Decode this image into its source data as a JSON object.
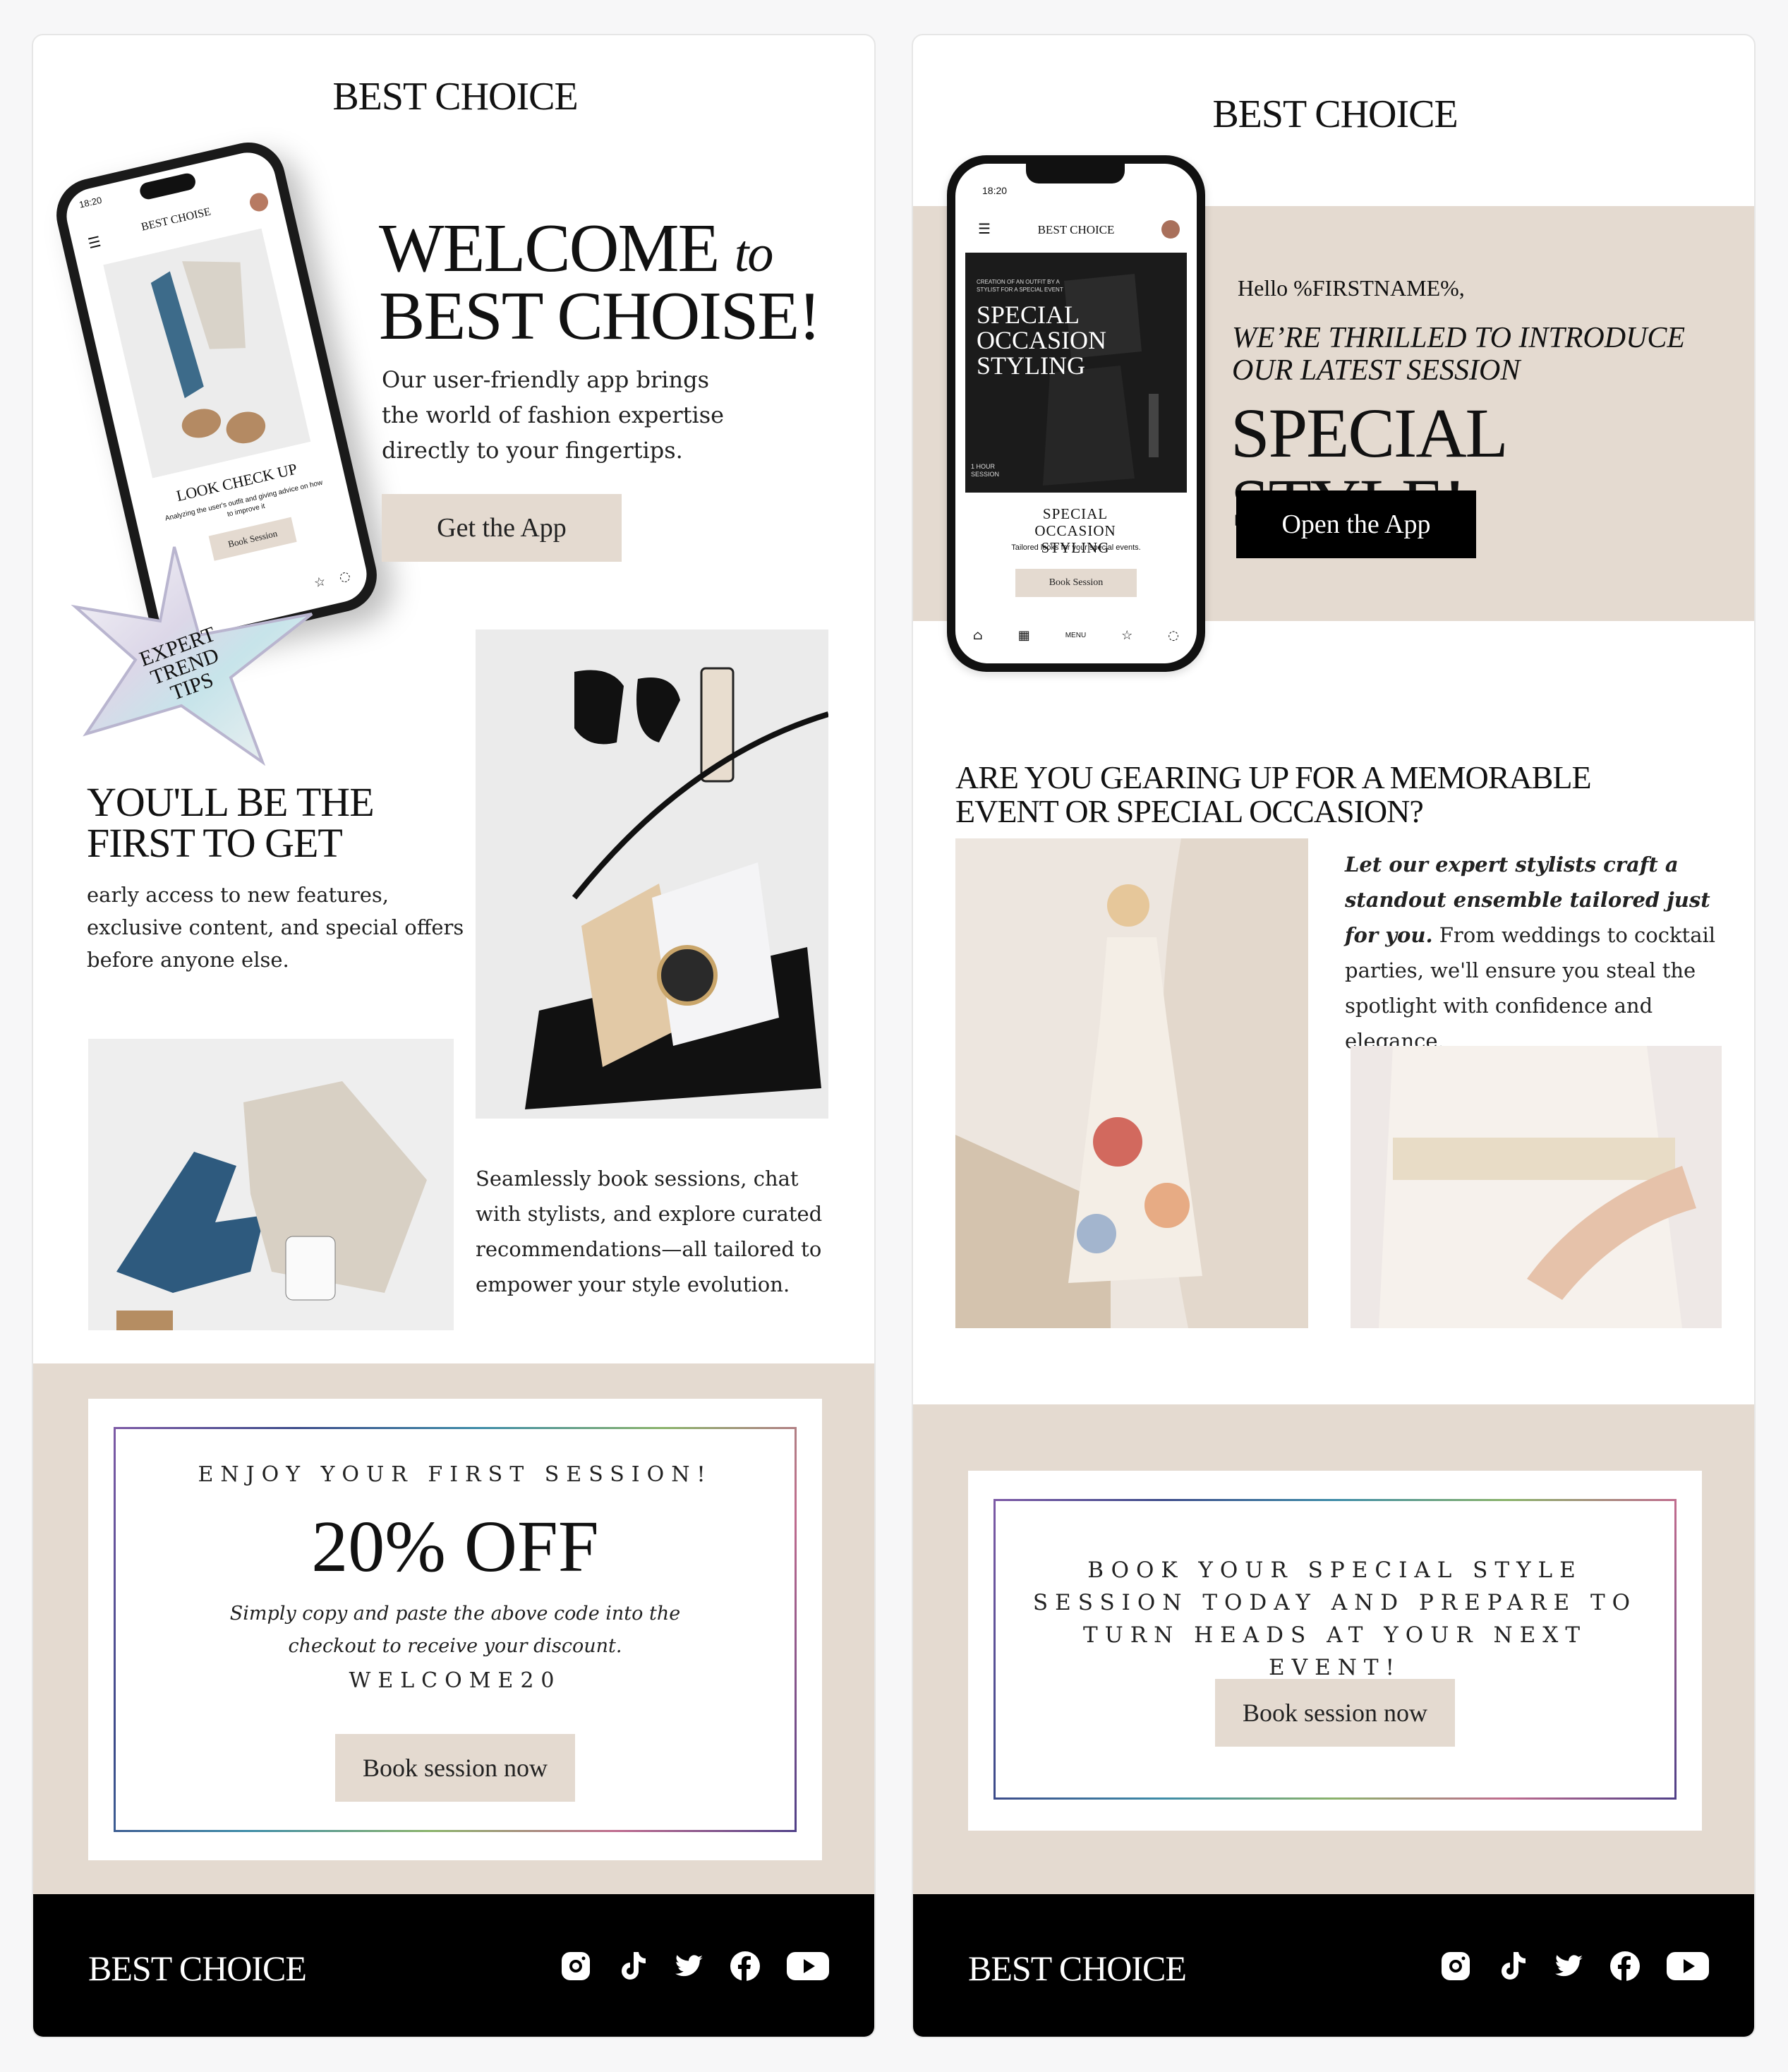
{
  "left": {
    "brand": "BEST CHOICE",
    "phone": {
      "time": "18:20",
      "brand": "BEST CHOISE",
      "card_title": "LOOK CHECK UP",
      "card_sub": "Analyzing the user's outfit and giving advice on how to improve it",
      "card_button": "Book Session",
      "sticker": "EXPERT TREND TIPS"
    },
    "hero": {
      "title_line1": "WELCOME",
      "title_to": "to",
      "title_line2": "BEST CHOISE!",
      "body": "Our user-friendly app brings the world of fashion expertise directly to your fingertips.",
      "button": "Get the App"
    },
    "first": {
      "title": "YOU'LL BE THE FIRST TO GET",
      "body": "early access to new features, exclusive content, and special offers before anyone else."
    },
    "seamless": "Seamlessly book sessions, chat with stylists, and explore curated recommendations—all tailored to empower your style evolution.",
    "promo": {
      "kicker": "ENJOY YOUR FIRST SESSION!",
      "headline": "20% OFF",
      "note": "Simply copy and paste the above code into the checkout to receive your discount.",
      "code": "WELCOME20",
      "button": "Book session now"
    },
    "footer_brand": "BEST CHOICE"
  },
  "right": {
    "brand": "BEST CHOICE",
    "phone": {
      "time": "18:20",
      "brand": "BEST CHOICE",
      "img_small": "CREATION OF AN OUTFIT BY A STYLIST FOR A SPECIAL EVENT",
      "img_title": "SPECIAL OCCASION STYLING",
      "img_session": "1 HOUR SESSION",
      "card_title": "SPECIAL OCCASION STYLING",
      "card_sub": "Tailored looks for your special events.",
      "card_button": "Book Session",
      "nav_menu": "MENU"
    },
    "hero": {
      "greeting": "Hello %FIRSTNAME%,",
      "intro": "WE’RE THRILLED TO INTRODUCE OUR LATEST SESSION",
      "title": "SPECIAL STYLE!",
      "button": "Open the App"
    },
    "question": "ARE YOU GEARING UP FOR A MEMORABLE EVENT OR SPECIAL OCCASION?",
    "stylist_bold": "Let our expert stylists craft a standout ensemble tailored just for you.",
    "stylist_rest": " From weddings to cocktail parties, we'll ensure you steal the spotlight with confidence and elegance.",
    "promo": {
      "text": "BOOK YOUR SPECIAL STYLE SESSION TODAY AND PREPARE TO TURN HEADS AT YOUR NEXT EVENT!",
      "button": "Book session now"
    },
    "footer_brand": "BEST CHOICE"
  },
  "socials": [
    "instagram-icon",
    "tiktok-icon",
    "twitter-icon",
    "facebook-icon",
    "youtube-icon"
  ],
  "colors": {
    "beige": "#e4dad0",
    "black": "#000000",
    "white": "#ffffff"
  }
}
